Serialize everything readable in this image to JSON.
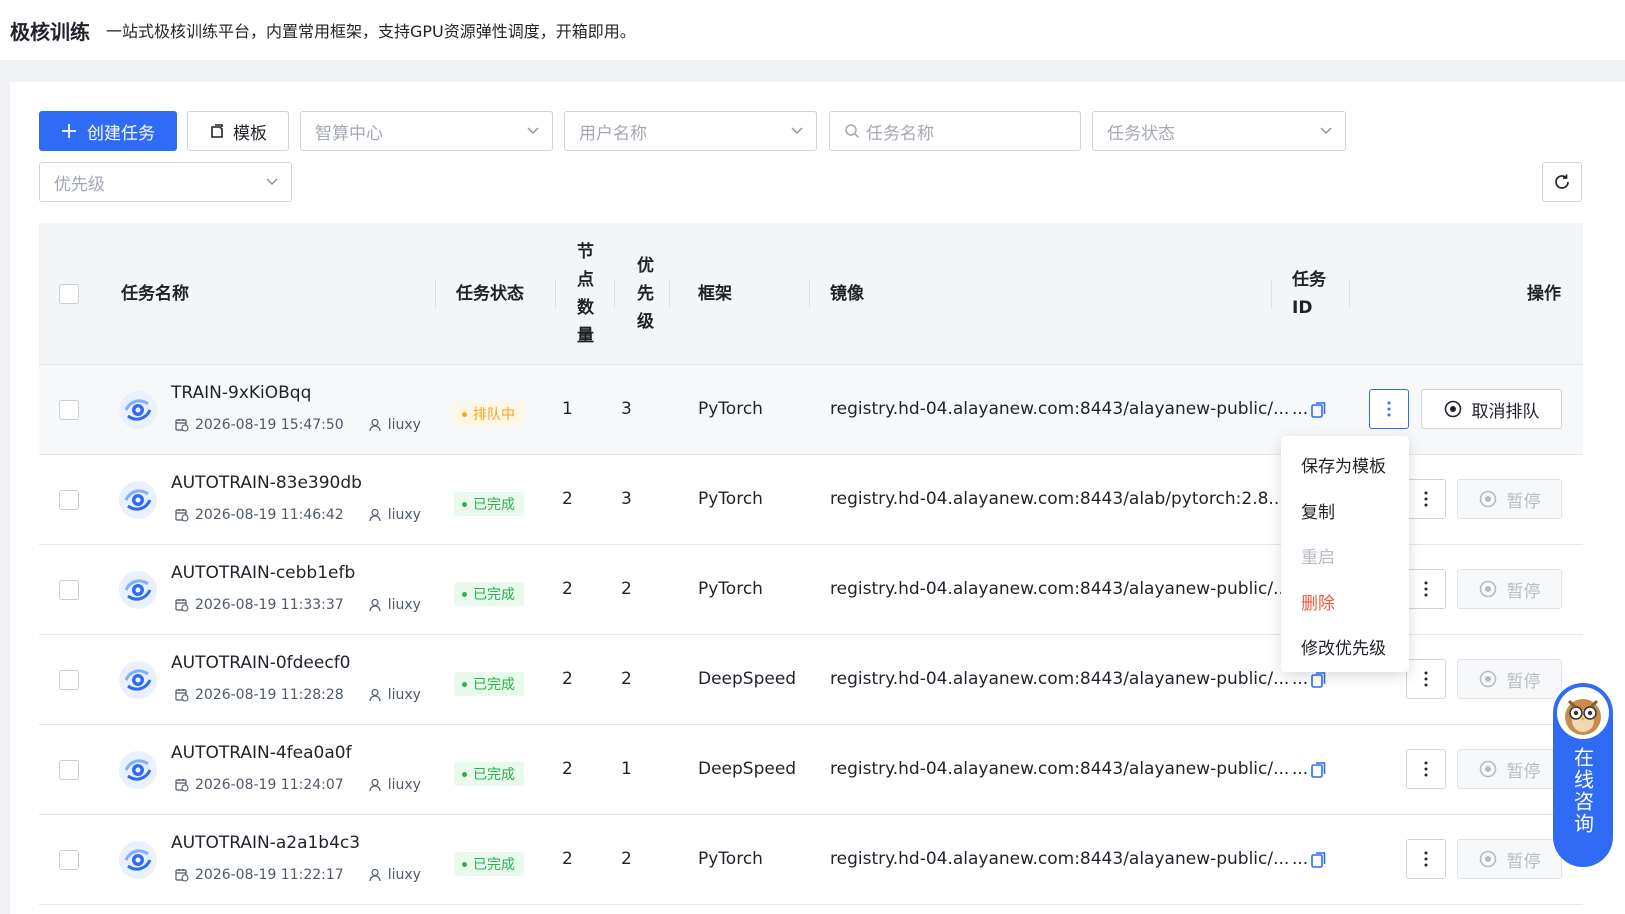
{
  "header": {
    "title": "极核训练",
    "description": "一站式极核训练平台，内置常用框架，支持GPU资源弹性调度，开箱即用。"
  },
  "toolbar": {
    "create_label": "创建任务",
    "template_label": "模板",
    "center_placeholder": "智算中心",
    "user_placeholder": "用户名称",
    "task_name_placeholder": "任务名称",
    "task_status_placeholder": "任务状态",
    "priority_placeholder": "优先级"
  },
  "table": {
    "columns": {
      "name": "任务名称",
      "status": "任务状态",
      "nodes": "节点数量",
      "priority": "优先级",
      "framework": "框架",
      "image": "镜像",
      "task_id": "任务 ID",
      "actions": "操作"
    },
    "rows": [
      {
        "name": "TRAIN-9xKiOBqq",
        "time": "2026-08-19 15:47:50",
        "user": "liuxy",
        "status": "排队中",
        "status_type": "queue",
        "nodes": "1",
        "priority": "3",
        "framework": "PyTorch",
        "image": "registry.hd-04.alayanew.com:8443/alayanew-public/...",
        "task_id": "...",
        "action": "取消排队",
        "action_disabled": false
      },
      {
        "name": "AUTOTRAIN-83e390db",
        "time": "2026-08-19 11:46:42",
        "user": "liuxy",
        "status": "已完成",
        "status_type": "done",
        "nodes": "2",
        "priority": "3",
        "framework": "PyTorch",
        "image": "registry.hd-04.alayanew.com:8443/alab/pytorch:2.8....",
        "task_id": "...",
        "action": "暂停",
        "action_disabled": true
      },
      {
        "name": "AUTOTRAIN-cebb1efb",
        "time": "2026-08-19 11:33:37",
        "user": "liuxy",
        "status": "已完成",
        "status_type": "done",
        "nodes": "2",
        "priority": "2",
        "framework": "PyTorch",
        "image": "registry.hd-04.alayanew.com:8443/alayanew-public/...",
        "task_id": "...",
        "action": "暂停",
        "action_disabled": true
      },
      {
        "name": "AUTOTRAIN-0fdeecf0",
        "time": "2026-08-19 11:28:28",
        "user": "liuxy",
        "status": "已完成",
        "status_type": "done",
        "nodes": "2",
        "priority": "2",
        "framework": "DeepSpeed",
        "image": "registry.hd-04.alayanew.com:8443/alayanew-public/...",
        "task_id": "...",
        "action": "暂停",
        "action_disabled": true
      },
      {
        "name": "AUTOTRAIN-4fea0a0f",
        "time": "2026-08-19 11:24:07",
        "user": "liuxy",
        "status": "已完成",
        "status_type": "done",
        "nodes": "2",
        "priority": "1",
        "framework": "DeepSpeed",
        "image": "registry.hd-04.alayanew.com:8443/alayanew-public/...",
        "task_id": "...",
        "action": "暂停",
        "action_disabled": true
      },
      {
        "name": "AUTOTRAIN-a2a1b4c3",
        "time": "2026-08-19 11:22:17",
        "user": "liuxy",
        "status": "已完成",
        "status_type": "done",
        "nodes": "2",
        "priority": "2",
        "framework": "PyTorch",
        "image": "registry.hd-04.alayanew.com:8443/alayanew-public/...",
        "task_id": "...",
        "action": "暂停",
        "action_disabled": true
      }
    ]
  },
  "dropdown_menu": {
    "items": [
      "保存为模板",
      "复制",
      "重启",
      "删除",
      "修改优先级"
    ]
  },
  "consult": {
    "label": "在线咨询"
  },
  "colors": {
    "primary": "#2f6bf5",
    "queue": "#f5a623",
    "done": "#28b449",
    "danger": "#f5553c"
  }
}
